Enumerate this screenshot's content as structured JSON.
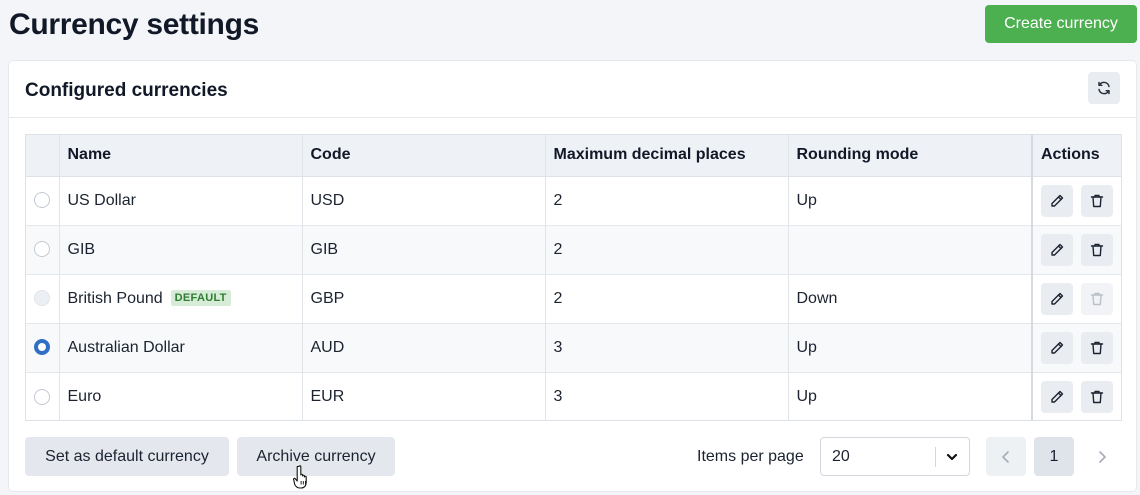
{
  "header": {
    "title": "Currency settings",
    "create_button": "Create currency"
  },
  "card": {
    "title": "Configured currencies",
    "refresh_icon": "refresh-icon"
  },
  "table": {
    "columns": [
      "Name",
      "Code",
      "Maximum decimal places",
      "Rounding mode",
      "Actions"
    ],
    "rows": [
      {
        "name": "US Dollar",
        "badge": "",
        "code": "USD",
        "decimals": "2",
        "rounding": "Up",
        "radio": "unchecked",
        "delete_enabled": true
      },
      {
        "name": "GIB",
        "badge": "",
        "code": "GIB",
        "decimals": "2",
        "rounding": "",
        "radio": "unchecked",
        "delete_enabled": true
      },
      {
        "name": "British Pound",
        "badge": "DEFAULT",
        "code": "GBP",
        "decimals": "2",
        "rounding": "Down",
        "radio": "disabled",
        "delete_enabled": false
      },
      {
        "name": "Australian Dollar",
        "badge": "",
        "code": "AUD",
        "decimals": "3",
        "rounding": "Up",
        "radio": "checked",
        "delete_enabled": true
      },
      {
        "name": "Euro",
        "badge": "",
        "code": "EUR",
        "decimals": "3",
        "rounding": "Up",
        "radio": "unchecked",
        "delete_enabled": true
      }
    ]
  },
  "footer": {
    "set_default_button": "Set as default currency",
    "archive_button": "Archive currency",
    "items_per_page_label": "Items per page",
    "items_per_page_value": "20",
    "current_page": "1"
  },
  "colors": {
    "accent_green": "#4caf50",
    "radio_selected": "#2f6fc4",
    "badge_bg": "#d6ecd7",
    "badge_text": "#2e7d32"
  }
}
